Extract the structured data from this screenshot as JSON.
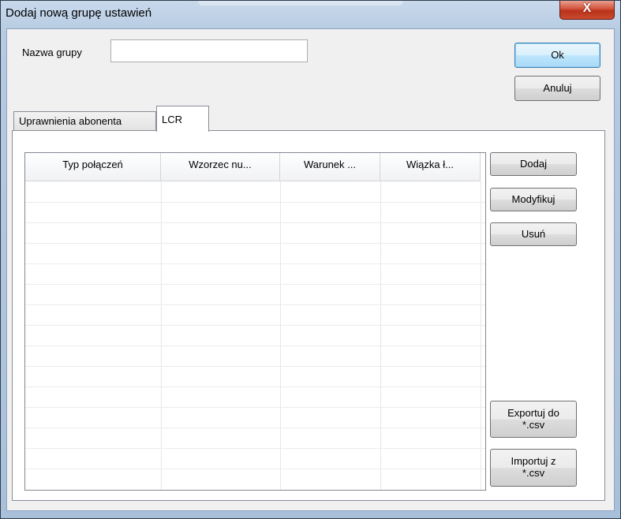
{
  "window": {
    "title": "Dodaj nową grupę ustawień",
    "close_glyph": "X"
  },
  "form": {
    "group_name_label": "Nazwa grupy",
    "group_name_value": ""
  },
  "buttons": {
    "ok": "Ok",
    "cancel": "Anuluj"
  },
  "tabs": [
    {
      "label": "Uprawnienia abonenta",
      "active": false
    },
    {
      "label": "LCR",
      "active": true
    }
  ],
  "table": {
    "columns": [
      "Typ połączeń",
      "Wzorzec nu...",
      "Warunek ...",
      "Wiązka ł..."
    ],
    "rows": []
  },
  "side_buttons": {
    "add": "Dodaj",
    "modify": "Modyfikuj",
    "delete": "Usuń",
    "export": "Exportuj do\n*.csv",
    "import": "Importuj z\n*.csv"
  }
}
